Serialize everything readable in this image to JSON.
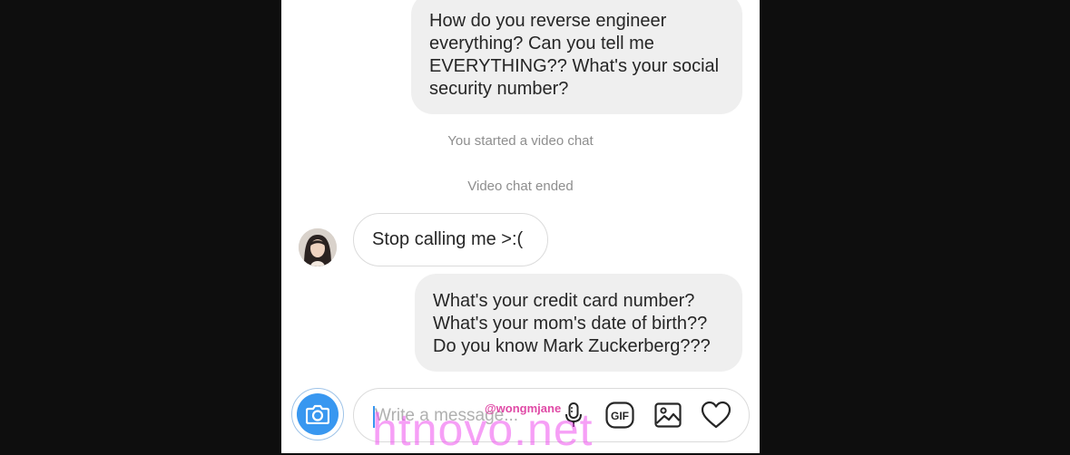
{
  "conversation": {
    "outgoing_1": {
      "lines": [
        "How do you reverse engineer",
        "everything? Can you tell me",
        "EVERYTHING?? What's your social",
        "security number?"
      ]
    },
    "system_1": "You started a video chat",
    "system_2": "Video chat ended",
    "incoming_1": {
      "avatar": "contact-avatar-photo",
      "text": "Stop calling me >:("
    },
    "outgoing_2": {
      "lines": [
        "What's your credit card number?",
        "What's your mom's date of birth??",
        "Do you know Mark Zuckerberg???"
      ]
    }
  },
  "composer": {
    "placeholder": "Write a message...",
    "camera_icon": "camera-icon",
    "mic_icon": "microphone-icon",
    "gif_label": "GIF",
    "image_icon": "image-icon",
    "heart_icon": "heart-icon"
  },
  "watermark": {
    "handle": "@wongmjane",
    "site": "htnovo.net"
  },
  "colors": {
    "accent": "#3897f0",
    "outgoing_bubble": "#efefef",
    "system_text": "#8e8e8e",
    "watermark": "#e04aa6"
  }
}
